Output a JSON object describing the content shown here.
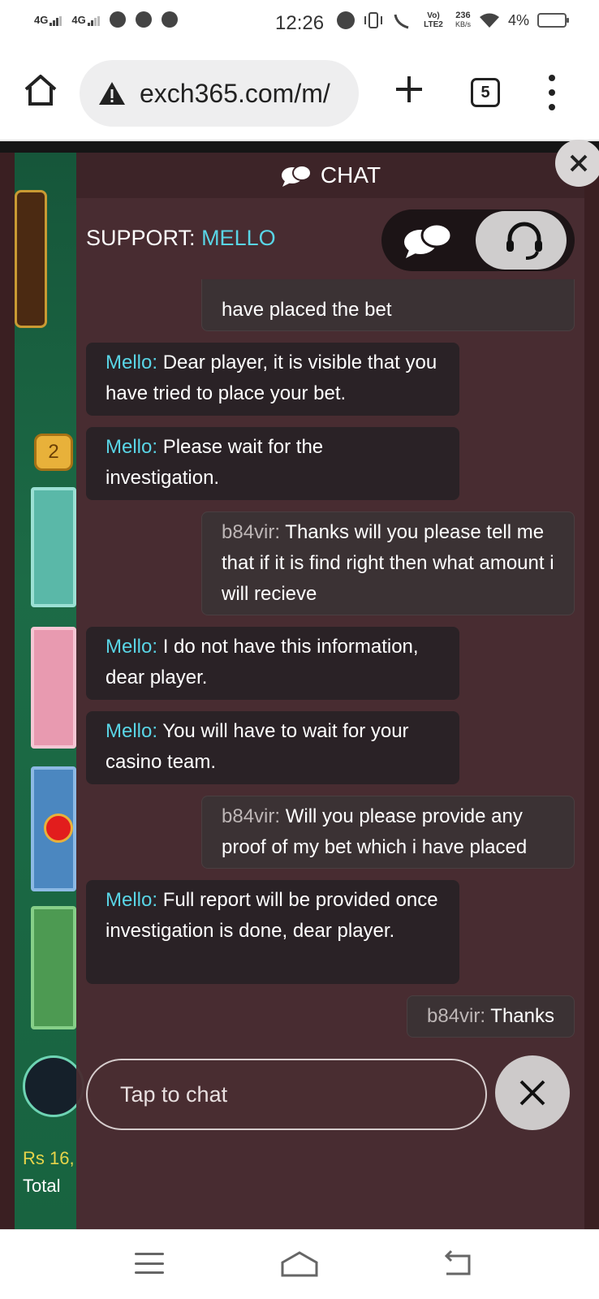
{
  "statusbar": {
    "sim1": "4G",
    "sim2": "4G",
    "time": "12:26",
    "volte": "Vo) LTE2",
    "speed_value": "236",
    "speed_unit": "KB/s",
    "battery": "4%"
  },
  "browser": {
    "url": "exch365.com/m/",
    "tab_count": "5"
  },
  "game": {
    "level_badge": "2",
    "stake": "Rs 16,",
    "total": "Total"
  },
  "chat": {
    "title": "CHAT",
    "support_label": "SUPPORT:",
    "support_name": "MELLO",
    "input_placeholder": "Tap to chat",
    "messages": [
      {
        "sender": "",
        "text": "have placed the bet"
      },
      {
        "sender": "Mello:",
        "text": "Dear player, it is visible that you have tried to place your bet."
      },
      {
        "sender": "Mello:",
        "text": "Please wait for the investigation."
      },
      {
        "sender": "b84vir:",
        "text": "Thanks will you please tell me that if it is find right then what amount i will recieve"
      },
      {
        "sender": "Mello:",
        "text": "I do not have this information, dear player."
      },
      {
        "sender": "Mello:",
        "text": "You will have to wait for your casino team."
      },
      {
        "sender": "b84vir:",
        "text": "Will you please provide any proof of my bet which i have placed"
      },
      {
        "sender": "Mello:",
        "text": "Full report will be provided once investigation is done, dear player."
      },
      {
        "sender": "b84vir:",
        "text": "Thanks"
      }
    ]
  },
  "icons": {
    "home": "home-icon",
    "warning": "warning-icon",
    "plus": "plus-icon",
    "more": "more-vert-icon",
    "chat_bubbles": "chat-bubbles-icon",
    "headset": "headset-icon",
    "close": "close-icon",
    "menu": "menu-icon",
    "back": "back-icon"
  },
  "colors": {
    "support_accent": "#59d5e6",
    "panel_bg": "#492d32"
  }
}
